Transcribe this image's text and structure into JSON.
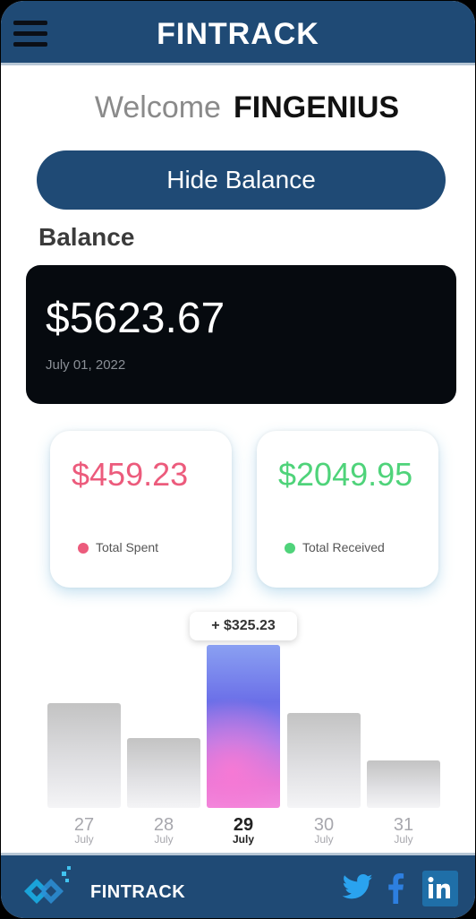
{
  "header": {
    "title": "FINTRACK",
    "menu_icon": "hamburger-menu-icon"
  },
  "welcome": {
    "greeting": "Welcome",
    "name": "FINGENIUS"
  },
  "actions": {
    "hide_balance_label": "Hide Balance"
  },
  "balance": {
    "label": "Balance",
    "amount": "$5623.67",
    "date": "July 01, 2022"
  },
  "stats": [
    {
      "amount": "$459.23",
      "label": "Total Spent",
      "color": "#ec5b7c"
    },
    {
      "amount": "$2049.95",
      "label": "Total Received",
      "color": "#4fd37a"
    }
  ],
  "chart": {
    "tooltip": "+ $325.23",
    "active_index": 2,
    "bars": [
      {
        "day": "27",
        "month": "July"
      },
      {
        "day": "28",
        "month": "July"
      },
      {
        "day": "29",
        "month": "July"
      },
      {
        "day": "30",
        "month": "July"
      },
      {
        "day": "31",
        "month": "July"
      }
    ]
  },
  "footer": {
    "brand": "FINTRACK",
    "logo_icon": "fintrack-logo-icon",
    "social": [
      "twitter-icon",
      "facebook-icon",
      "linkedin-icon"
    ]
  },
  "colors": {
    "primary": "#1f4a75",
    "spent": "#ec5b7c",
    "received": "#4fd37a",
    "balance_card": "#060a0f"
  }
}
